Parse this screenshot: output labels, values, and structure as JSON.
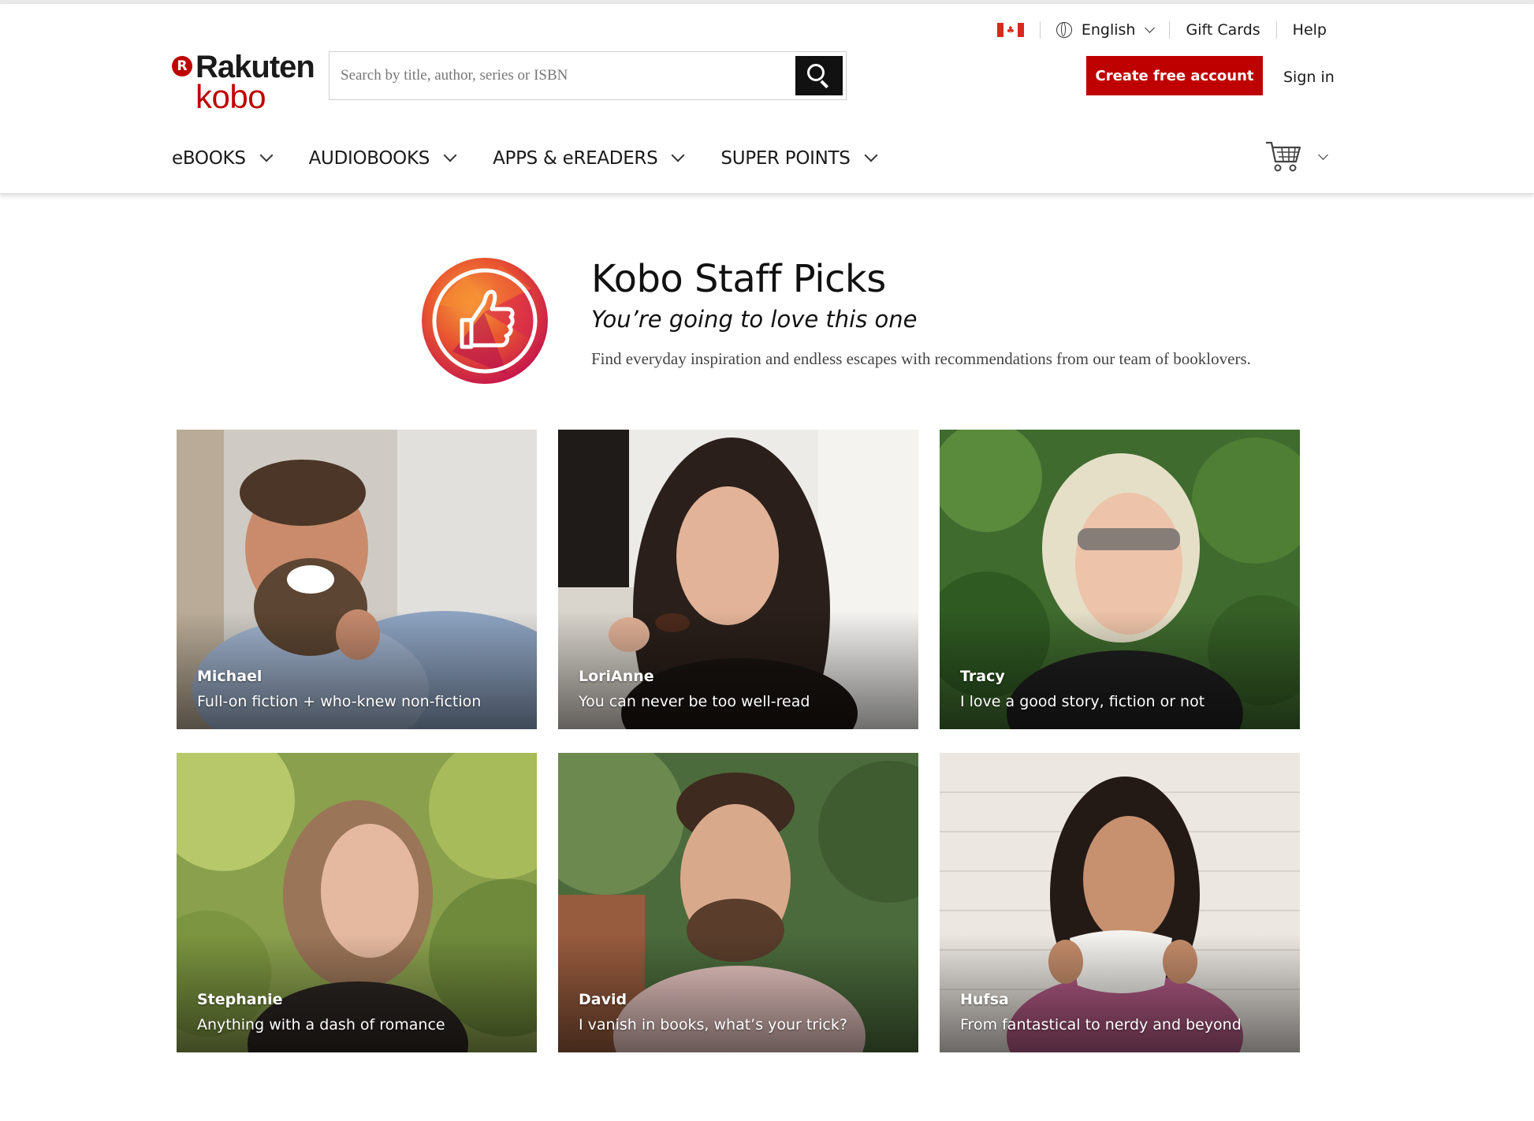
{
  "header": {
    "utility": {
      "country_flag_icon": "canada-flag",
      "language": "English",
      "gift_cards": "Gift Cards",
      "help": "Help"
    },
    "logo": {
      "line1": "Rakuten",
      "line2": "kobo",
      "badge_letter": "R"
    },
    "search": {
      "placeholder": "Search by title, author, series or ISBN",
      "value": ""
    },
    "account": {
      "create": "Create free account",
      "signin": "Sign in"
    },
    "nav": [
      {
        "label": "eBOOKS"
      },
      {
        "label": "AUDIOBOOKS"
      },
      {
        "label": "APPS & eREADERS"
      },
      {
        "label": "SUPER POINTS"
      }
    ]
  },
  "hero": {
    "title": "Kobo Staff Picks",
    "subtitle": "You’re going to love this one",
    "description": "Find everyday inspiration and endless escapes with recommendations from our team of booklovers.",
    "badge_icon": "thumbs-up-icon"
  },
  "staff": [
    {
      "name": "Michael",
      "tagline": "Full-on fiction + who-knew non-fiction"
    },
    {
      "name": "LoriAnne",
      "tagline": "You can never be too well-read"
    },
    {
      "name": "Tracy",
      "tagline": "I love a good story, fiction or not"
    },
    {
      "name": "Stephanie",
      "tagline": "Anything with a dash of romance"
    },
    {
      "name": "David",
      "tagline": "I vanish in books, what’s your trick?"
    },
    {
      "name": "Hufsa",
      "tagline": "From fantastical to nerdy and beyond"
    }
  ],
  "colors": {
    "brand_red": "#bf0000",
    "text_dark": "#1a1a1a"
  }
}
